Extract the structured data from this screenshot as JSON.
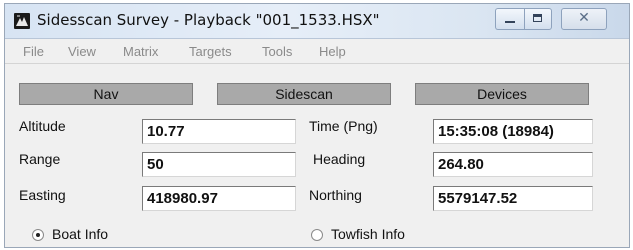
{
  "window": {
    "title": "Sidesscan Survey - Playback \"001_1533.HSX\"",
    "close_glyph": "✕"
  },
  "icons": {
    "app": "sidescan-app-icon",
    "minimize": "minimize-icon",
    "maximize": "maximize-icon",
    "close": "close-icon"
  },
  "menu": [
    "File",
    "View",
    "Matrix",
    "Targets",
    "Tools",
    "Help"
  ],
  "nav_buttons": {
    "nav": "Nav",
    "sidescan": "Sidescan",
    "devices": "Devices"
  },
  "fields": {
    "altitude": {
      "label": "Altitude",
      "value": "10.77"
    },
    "range": {
      "label": "Range",
      "value": "50"
    },
    "easting": {
      "label": "Easting",
      "value": "418980.97"
    },
    "time_ping": {
      "label": "Time (Png)",
      "value": "15:35:08 (18984)"
    },
    "heading": {
      "label": "Heading",
      "value": "264.80"
    },
    "northing": {
      "label": "Northing",
      "value": "5579147.52"
    }
  },
  "radios": {
    "boat_info": {
      "label": "Boat Info",
      "checked": true
    },
    "towfish_info": {
      "label": "Towfish Info",
      "checked": false
    }
  },
  "colors": {
    "nav_button_bg": "#a9a9a9",
    "titlebar": "#dbe6f2",
    "menu_text": "#8a8a8a"
  }
}
